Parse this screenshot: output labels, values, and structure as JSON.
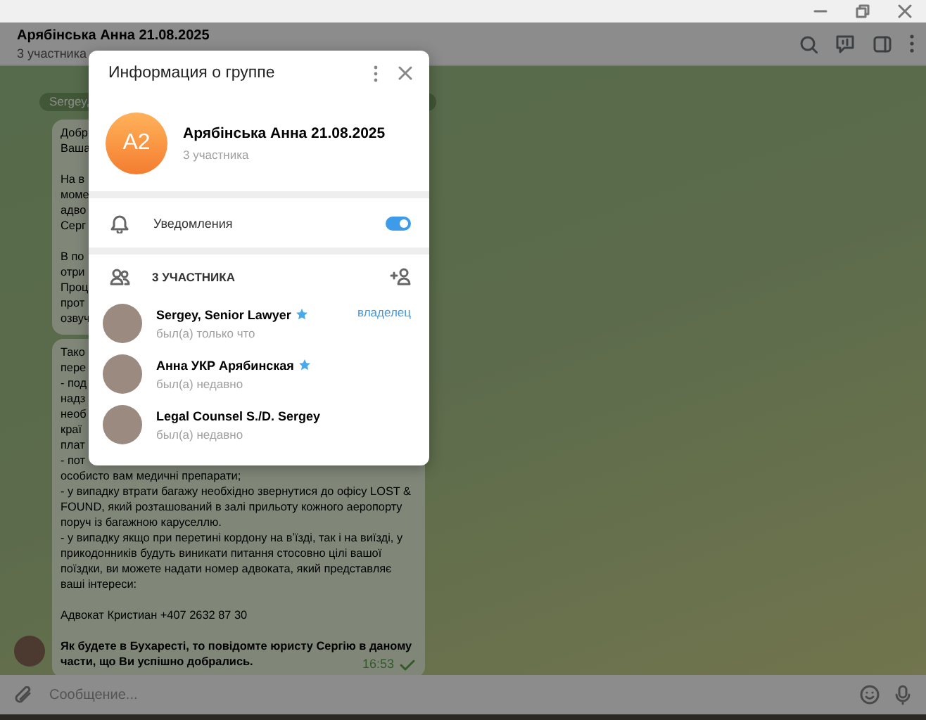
{
  "chat_header": {
    "title": "Арябінська Анна 21.08.2025",
    "subtitle": "3 участника"
  },
  "chat": {
    "sender_label": "Sergey,",
    "messages": [
      {
        "paragraphs": [
          {
            "lines": [
              "Добр",
              "Ваша"
            ],
            "bold": false
          },
          {
            "lines": [
              "На в",
              "моме",
              "адво",
              "Серг"
            ],
            "bold": false
          },
          {
            "lines": [
              "В по",
              "отри",
              "Проц",
              "прот",
              "озвуч"
            ],
            "bold": false
          }
        ]
      },
      {
        "paragraphs": [
          {
            "lines": [
              "Тако",
              "пере",
              "- под",
              "надз",
              "необ",
              "краї",
              "плат",
              "- пот",
              "особисто вам медичні препарати;",
              "- у випадку втрати багажу необхідно звернутися до офісу LOST &",
              "FOUND, який розташований в залі прильоту кожного аеропорту",
              "поруч із багажною каруселлю.",
              "- у випадку якщо при перетині кордону на вʼїзді, так і на виїзді, у",
              "прикодонників будуть виникати питання стосовно цілі вашої",
              "поїздки, ви можете надати номер адвоката, який представляє",
              "ваші інтереси:"
            ],
            "bold": false
          },
          {
            "lines": [
              "Адвокат Кристиан +407 2632 87 30"
            ],
            "bold": false
          },
          {
            "lines": [
              "Як будете в Бухаресті, то повідомте юристу Сергію в даному",
              "части, що Ви успішно добрались."
            ],
            "bold": true
          }
        ],
        "time": "16:53",
        "read": true
      }
    ]
  },
  "composer": {
    "placeholder": "Сообщение..."
  },
  "group_info": {
    "title": "Информация о группе",
    "avatar_initials": "A2",
    "name": "Арябінська Анна 21.08.2025",
    "subtitle": "3 участника",
    "notifications": {
      "label": "Уведомления",
      "on": true
    },
    "members_header": "3 УЧАСТНИКА",
    "members": [
      {
        "name": "Sergey, Senior Lawyer",
        "starred": true,
        "status": "был(а) только что",
        "role": "владелец"
      },
      {
        "name": "Анна УКР Арябинская",
        "starred": true,
        "status": "был(а) недавно"
      },
      {
        "name": "Legal Counsel S./D. Sergey",
        "starred": false,
        "status": "был(а) недавно"
      }
    ]
  }
}
